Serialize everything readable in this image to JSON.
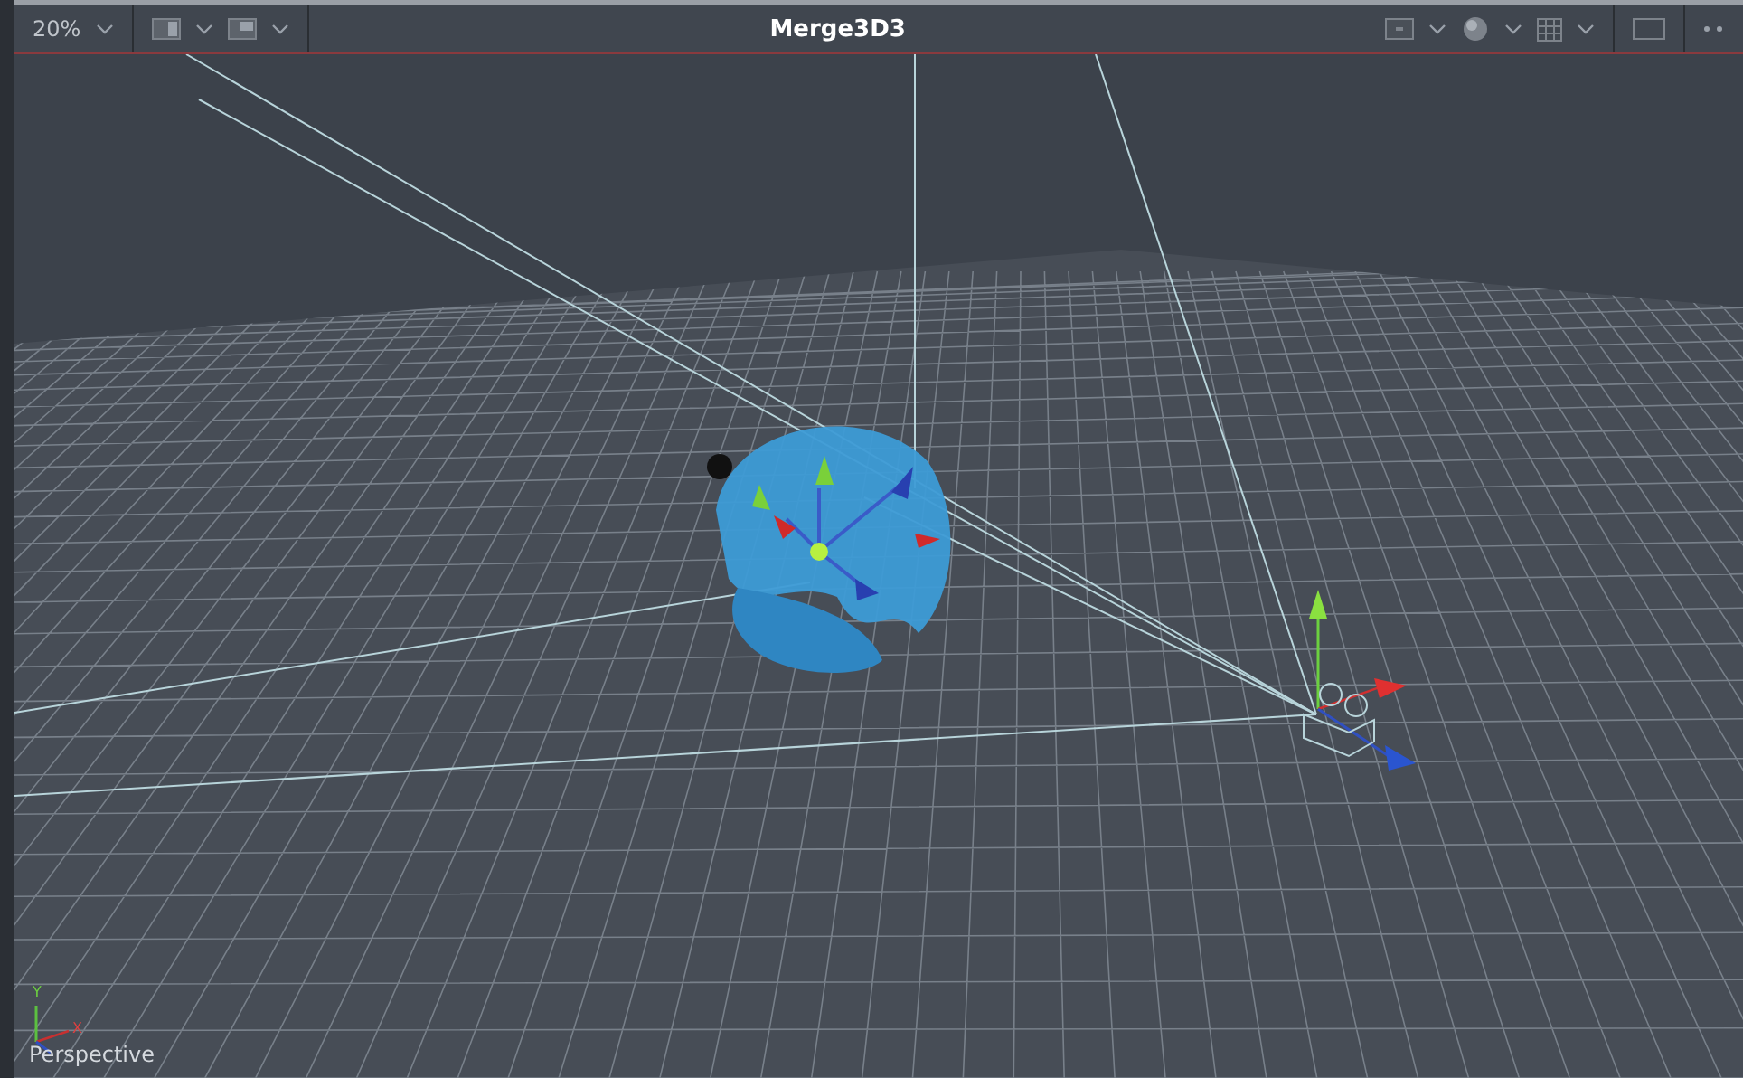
{
  "toolbar": {
    "zoom": "20%",
    "title": "Merge3D3"
  },
  "viewport": {
    "view_label": "Perspective",
    "axis_labels": [
      "Y",
      "X"
    ]
  }
}
